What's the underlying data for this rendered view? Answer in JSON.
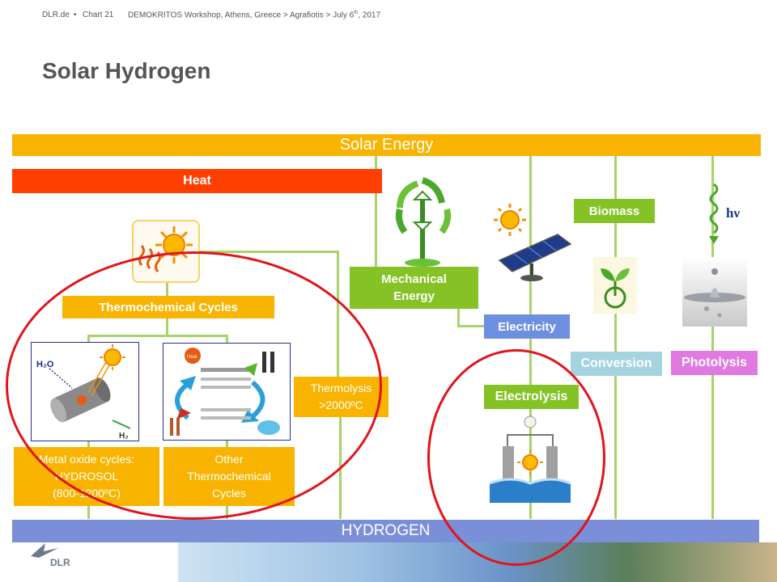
{
  "header": {
    "site": "DLR.de",
    "bullet": "•",
    "chart": "Chart 21",
    "event": "DEMOKRITOS Workshop, Athens, Greece  >  Agrafiotis > July 6",
    "sup": "th",
    "year": ", 2017"
  },
  "title": "Solar Hydrogen",
  "diagram": {
    "solar_energy": "Solar Energy",
    "heat": "Heat",
    "thermochemical_cycles": "Thermochemical Cycles",
    "metal_oxide": [
      "Metal oxide cycles:",
      "HYDROSOL",
      "(800-1200ºC)"
    ],
    "other_thermo": [
      "Other",
      "Thermochemical",
      "Cycles"
    ],
    "thermolysis": [
      "Thermolysis",
      ">2000ºC"
    ],
    "mechanical_energy": [
      "Mechanical",
      "Energy"
    ],
    "electricity": "Electricity",
    "electrolysis": "Electrolysis",
    "biomass": "Biomass",
    "conversion": "Conversion",
    "photolysis": "Photolysis",
    "hydrogen": "HYDROGEN",
    "hv": "hν",
    "h2o": "H₂O",
    "h2": "H₂",
    "heat_small": "Heat",
    "logo": "DLR"
  },
  "colors": {
    "orange": "#f8b400",
    "green": "#84c225",
    "red": "#ff3f00",
    "blue": "#6d8fe0",
    "circle": "#e0141b"
  }
}
